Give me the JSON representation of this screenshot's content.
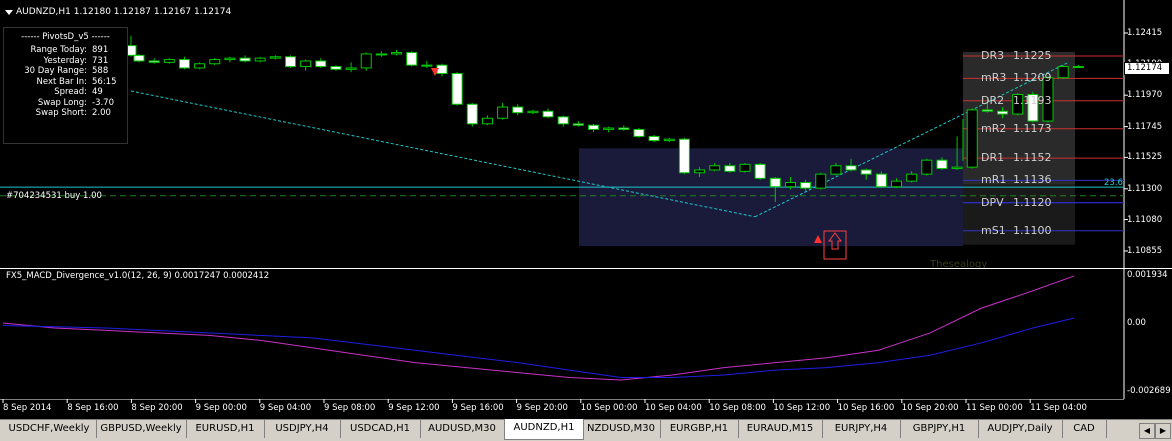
{
  "main_chart": {
    "header": "AUDNZD,H1  1.12180 1.12187 1.12167 1.12174",
    "current_price": "1.12174",
    "price_labels": [
      "1.12415",
      "1.12190",
      "1.11970",
      "1.11745",
      "1.11525",
      "1.11300",
      "1.11080",
      "1.10855"
    ],
    "trade_line_label": "#704234531 buy 1.00",
    "trade_price": 1.11312,
    "fib_label": "23.6",
    "watermark": "Thesealogy",
    "info_panel": {
      "title": "------  PivotsD_v5  ------",
      "rows": [
        {
          "label": "Range  Today:",
          "value": "891"
        },
        {
          "label": "Yesterday:",
          "value": "731"
        },
        {
          "label": "30 Day Range:",
          "value": "588"
        },
        {
          "label": "Next Bar In:",
          "value": "56:15"
        },
        {
          "label": "Spread:",
          "value": "49"
        },
        {
          "label": "Swap  Long:",
          "value": "-3.70"
        },
        {
          "label": "Swap  Short:",
          "value": "2.00"
        }
      ]
    },
    "pivots": [
      {
        "name": "DR3",
        "value": "1.1225",
        "price": 1.1225,
        "color": "#c83232"
      },
      {
        "name": "mR3",
        "value": "1.1209",
        "price": 1.1209,
        "color": "#c83232"
      },
      {
        "name": "DR2",
        "value": "1.1193",
        "price": 1.1193,
        "color": "#c83232"
      },
      {
        "name": "mR2",
        "value": "1.1173",
        "price": 1.1173,
        "color": "#c83232"
      },
      {
        "name": "DR1",
        "value": "1.1152",
        "price": 1.1152,
        "color": "#c83232"
      },
      {
        "name": "mR1",
        "value": "1.1136",
        "price": 1.1136,
        "color": "#3232c8"
      },
      {
        "name": "DPV",
        "value": "1.1120",
        "price": 1.112,
        "color": "#3232ff"
      },
      {
        "name": "mS1",
        "value": "1.1100",
        "price": 1.11,
        "color": "#3232c8"
      }
    ]
  },
  "indicator": {
    "header": "FX5_MACD_Divergence_v1.0(12, 26, 9) 0.0017247 0.0002412",
    "scale_labels": [
      "0.001934",
      "0.00",
      "-0.002689"
    ]
  },
  "time_axis": [
    "8 Sep 2014",
    "8 Sep 16:00",
    "8 Sep 20:00",
    "9 Sep 00:00",
    "9 Sep 04:00",
    "9 Sep 08:00",
    "9 Sep 12:00",
    "9 Sep 16:00",
    "9 Sep 20:00",
    "10 Sep 00:00",
    "10 Sep 04:00",
    "10 Sep 08:00",
    "10 Sep 12:00",
    "10 Sep 16:00",
    "10 Sep 20:00",
    "11 Sep 00:00",
    "11 Sep 04:00"
  ],
  "tabs": [
    "USDCHF,Weekly",
    "GBPUSD,Weekly",
    "EURUSD,H1",
    "USDJPY,H4",
    "USDCAD,H1",
    "AUDUSD,M30",
    "AUDNZD,H1",
    "NZDUSD,M30",
    "EURGBP,H1",
    "EURAUD,M15",
    "EURJPY,H4",
    "GBPJPY,H1",
    "AUDJPY,Daily",
    "CAD"
  ],
  "active_tab": "AUDNZD,H1",
  "colors": {
    "bull": "#00c800",
    "bear": "#ffffff",
    "signal": "#ff3030",
    "macd_main": "#c832c8",
    "macd_signal": "#1e1ee6"
  },
  "candles": [
    [
      1.12325,
      1.12395,
      1.12245,
      1.12255
    ],
    [
      1.12255,
      1.12265,
      1.12205,
      1.12215
    ],
    [
      1.12215,
      1.12235,
      1.12195,
      1.12205
    ],
    [
      1.12205,
      1.12235,
      1.12195,
      1.12225
    ],
    [
      1.12225,
      1.12245,
      1.12155,
      1.12165
    ],
    [
      1.12165,
      1.12205,
      1.12155,
      1.12195
    ],
    [
      1.12195,
      1.12235,
      1.12185,
      1.12225
    ],
    [
      1.12225,
      1.12245,
      1.12205,
      1.12235
    ],
    [
      1.12235,
      1.12255,
      1.12205,
      1.12215
    ],
    [
      1.12215,
      1.12245,
      1.12205,
      1.12235
    ],
    [
      1.12235,
      1.12255,
      1.12225,
      1.12245
    ],
    [
      1.12245,
      1.12255,
      1.12165,
      1.12175
    ],
    [
      1.12175,
      1.12225,
      1.12145,
      1.12215
    ],
    [
      1.12215,
      1.12235,
      1.12165,
      1.12175
    ],
    [
      1.12175,
      1.12185,
      1.12145,
      1.12155
    ],
    [
      1.12155,
      1.12205,
      1.12135,
      1.12165
    ],
    [
      1.12165,
      1.12275,
      1.12145,
      1.12265
    ],
    [
      1.12265,
      1.12285,
      1.12245,
      1.12265
    ],
    [
      1.12265,
      1.12295,
      1.12255,
      1.12275
    ],
    [
      1.12275,
      1.12285,
      1.12175,
      1.12185
    ],
    [
      1.12185,
      1.12215,
      1.12165,
      1.12185
    ],
    [
      1.12185,
      1.12195,
      1.12105,
      1.12125
    ],
    [
      1.12125,
      1.12135,
      1.11895,
      1.11905
    ],
    [
      1.11905,
      1.11915,
      1.11745,
      1.11765
    ],
    [
      1.11765,
      1.11825,
      1.11755,
      1.11805
    ],
    [
      1.11805,
      1.11915,
      1.11795,
      1.11885
    ],
    [
      1.11885,
      1.11905,
      1.11825,
      1.11845
    ],
    [
      1.11845,
      1.11865,
      1.11835,
      1.11855
    ],
    [
      1.11855,
      1.11875,
      1.11805,
      1.11815
    ],
    [
      1.11815,
      1.11825,
      1.11745,
      1.11765
    ],
    [
      1.11765,
      1.11785,
      1.11745,
      1.11755
    ],
    [
      1.11755,
      1.11765,
      1.11705,
      1.11725
    ],
    [
      1.11725,
      1.11745,
      1.11705,
      1.11735
    ],
    [
      1.11735,
      1.11755,
      1.11715,
      1.11725
    ],
    [
      1.11725,
      1.11735,
      1.11665,
      1.11675
    ],
    [
      1.11675,
      1.11685,
      1.11635,
      1.11645
    ],
    [
      1.11645,
      1.11665,
      1.11635,
      1.11655
    ],
    [
      1.11655,
      1.11665,
      1.11405,
      1.11415
    ],
    [
      1.11415,
      1.11455,
      1.11385,
      1.11435
    ],
    [
      1.11435,
      1.11485,
      1.11425,
      1.11465
    ],
    [
      1.11465,
      1.11485,
      1.11415,
      1.11425
    ],
    [
      1.11425,
      1.11485,
      1.11415,
      1.11475
    ],
    [
      1.11475,
      1.11485,
      1.11365,
      1.11375
    ],
    [
      1.11375,
      1.11385,
      1.11205,
      1.11315
    ],
    [
      1.11315,
      1.11385,
      1.11295,
      1.11345
    ],
    [
      1.11345,
      1.11365,
      1.11285,
      1.11305
    ],
    [
      1.11305,
      1.11415,
      1.11295,
      1.11405
    ],
    [
      1.11405,
      1.11485,
      1.11395,
      1.11465
    ],
    [
      1.11465,
      1.11515,
      1.11425,
      1.11435
    ],
    [
      1.11435,
      1.11445,
      1.11365,
      1.11405
    ],
    [
      1.11405,
      1.11425,
      1.11305,
      1.11315
    ],
    [
      1.11315,
      1.11375,
      1.11305,
      1.11355
    ],
    [
      1.11355,
      1.11425,
      1.11345,
      1.11405
    ],
    [
      1.11405,
      1.11515,
      1.11395,
      1.11505
    ],
    [
      1.11505,
      1.11525,
      1.11435,
      1.11445
    ],
    [
      1.11445,
      1.11675,
      1.11435,
      1.11455
    ],
    [
      1.11455,
      1.11875,
      1.11445,
      1.11865
    ],
    [
      1.11865,
      1.11945,
      1.11845,
      1.11855
    ],
    [
      1.11855,
      1.11885,
      1.11805,
      1.11835
    ],
    [
      1.11835,
      1.11985,
      1.11825,
      1.11975
    ],
    [
      1.11975,
      1.11995,
      1.11775,
      1.11785
    ],
    [
      1.11785,
      1.12105,
      1.11775,
      1.12095
    ],
    [
      1.12095,
      1.12185,
      1.12085,
      1.12175
    ],
    [
      1.12175,
      1.12187,
      1.12167,
      1.12174
    ]
  ],
  "candle_times": [
    18,
    18.5,
    19,
    20,
    21,
    22,
    23,
    24,
    25,
    26,
    27,
    28,
    29,
    30,
    31,
    32,
    33,
    34,
    35,
    36,
    37,
    38,
    39,
    40,
    41,
    42,
    43,
    44,
    45,
    46,
    47,
    48,
    49,
    50,
    51,
    52,
    53,
    54,
    55,
    56,
    57,
    58,
    59,
    60,
    61,
    62,
    63,
    64,
    65,
    66,
    67,
    68,
    69,
    70,
    71,
    72,
    73,
    74,
    75,
    76,
    77,
    78,
    79,
    80
  ],
  "macd_main": [
    [
      0,
      0.0
    ],
    [
      5,
      -0.0002
    ],
    [
      10,
      -0.0003
    ],
    [
      15,
      -0.0004
    ],
    [
      20,
      -0.0005
    ],
    [
      25,
      -0.0007
    ],
    [
      30,
      -0.001
    ],
    [
      35,
      -0.0013
    ],
    [
      40,
      -0.0016
    ],
    [
      45,
      -0.0018
    ],
    [
      50,
      -0.002
    ],
    [
      55,
      -0.0022
    ],
    [
      60,
      -0.0023
    ],
    [
      65,
      -0.0021
    ],
    [
      70,
      -0.0018
    ],
    [
      75,
      -0.0016
    ],
    [
      80,
      -0.0014
    ],
    [
      85,
      -0.0011
    ],
    [
      90,
      -0.0004
    ],
    [
      95,
      0.0006
    ],
    [
      100,
      0.0013
    ],
    [
      104,
      0.0019
    ]
  ],
  "macd_signal": [
    [
      0,
      -0.0001
    ],
    [
      10,
      -0.0002
    ],
    [
      20,
      -0.0004
    ],
    [
      30,
      -0.0006
    ],
    [
      40,
      -0.0011
    ],
    [
      50,
      -0.0016
    ],
    [
      55,
      -0.0019
    ],
    [
      60,
      -0.0022
    ],
    [
      65,
      -0.0022
    ],
    [
      70,
      -0.0021
    ],
    [
      75,
      -0.0019
    ],
    [
      80,
      -0.0018
    ],
    [
      85,
      -0.0016
    ],
    [
      90,
      -0.0013
    ],
    [
      95,
      -0.0008
    ],
    [
      100,
      -0.0002
    ],
    [
      104,
      0.0002
    ]
  ]
}
